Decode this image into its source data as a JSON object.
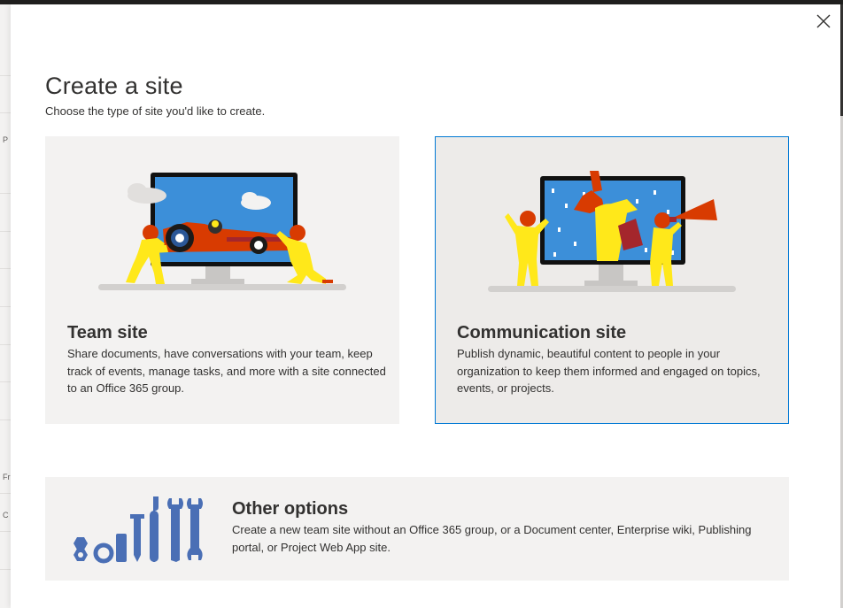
{
  "dialog": {
    "title": "Create a site",
    "subtitle": "Choose the type of site you'd like to create.",
    "close_label": "Close"
  },
  "cards": {
    "team": {
      "title": "Team site",
      "description": "Share documents, have conversations with your team, keep track of events, manage tasks, and more with a site connected to an Office 365 group."
    },
    "communication": {
      "title": "Communication site",
      "description": "Publish dynamic, beautiful content to people in your organization to keep them informed and engaged on topics, events, or projects."
    },
    "other": {
      "title": "Other options",
      "description": "Create a new team site without an Office 365 group, or a Document center, Enterprise wiki, Publishing portal, or Project Web App site."
    }
  },
  "background_sidebar_marks": [
    "P",
    "Fr",
    "C"
  ],
  "colors": {
    "accent": "#0078d4",
    "card_bg": "#f3f2f1",
    "card_selected_bg": "#edebe9",
    "monitor_screen": "#3c8fd9",
    "character_yellow": "#ffe81a",
    "car_red": "#d83b01",
    "tools_blue": "#4a6fb5"
  },
  "icons": [
    "close-icon",
    "race-car-illustration",
    "trophy-megaphone-illustration",
    "tools-illustration"
  ]
}
